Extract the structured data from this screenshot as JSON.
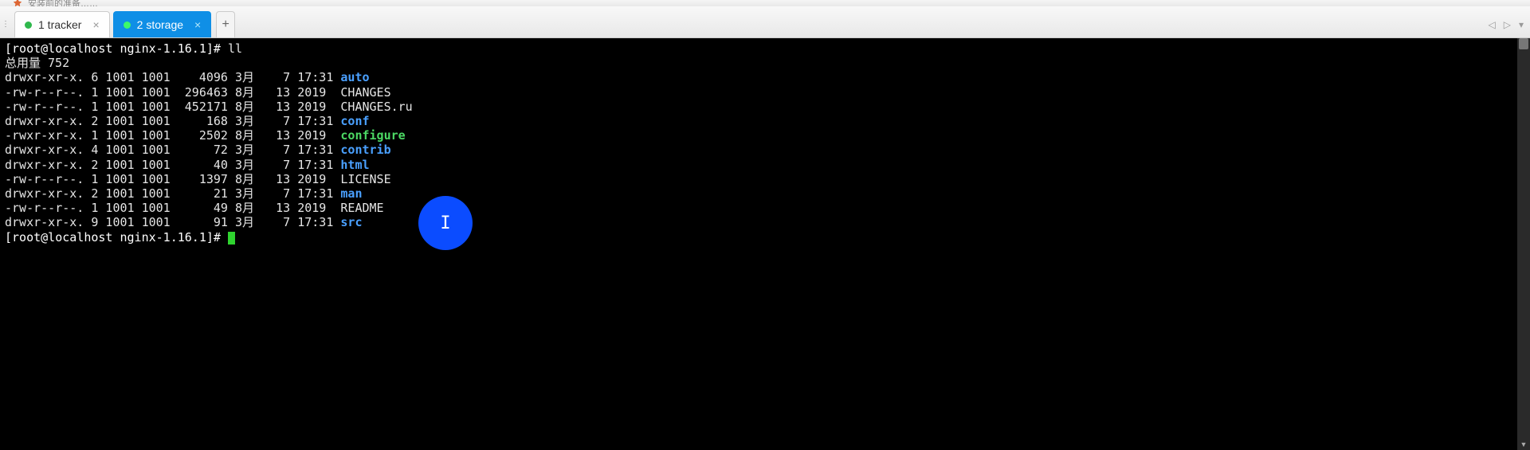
{
  "window": {
    "title_fragment": "安装前的准备……"
  },
  "tabs": {
    "items": [
      {
        "label": "1 tracker",
        "active": false
      },
      {
        "label": "2 storage",
        "active": true
      }
    ],
    "add_label": "+"
  },
  "navicons": {
    "back": "◁",
    "forward": "▷",
    "menu": "▾"
  },
  "terminal": {
    "prompt1": "[root@localhost nginx-1.16.1]# ",
    "cmd1": "ll",
    "total_line": "总用量 752",
    "rows": [
      {
        "perm": "drwxr-xr-x.",
        "n": "6",
        "u": "1001",
        "g": "1001",
        "size": "   4096",
        "mon": "3月 ",
        "day": "  7",
        "time": "17:31",
        "name": "auto",
        "cls": "dir"
      },
      {
        "perm": "-rw-r--r--.",
        "n": "1",
        "u": "1001",
        "g": "1001",
        "size": " 296463",
        "mon": "8月 ",
        "day": " 13",
        "time": "2019 ",
        "name": "CHANGES",
        "cls": ""
      },
      {
        "perm": "-rw-r--r--.",
        "n": "1",
        "u": "1001",
        "g": "1001",
        "size": " 452171",
        "mon": "8月 ",
        "day": " 13",
        "time": "2019 ",
        "name": "CHANGES.ru",
        "cls": ""
      },
      {
        "perm": "drwxr-xr-x.",
        "n": "2",
        "u": "1001",
        "g": "1001",
        "size": "    168",
        "mon": "3月 ",
        "day": "  7",
        "time": "17:31",
        "name": "conf",
        "cls": "dir"
      },
      {
        "perm": "-rwxr-xr-x.",
        "n": "1",
        "u": "1001",
        "g": "1001",
        "size": "   2502",
        "mon": "8月 ",
        "day": " 13",
        "time": "2019 ",
        "name": "configure",
        "cls": "exe"
      },
      {
        "perm": "drwxr-xr-x.",
        "n": "4",
        "u": "1001",
        "g": "1001",
        "size": "     72",
        "mon": "3月 ",
        "day": "  7",
        "time": "17:31",
        "name": "contrib",
        "cls": "dir"
      },
      {
        "perm": "drwxr-xr-x.",
        "n": "2",
        "u": "1001",
        "g": "1001",
        "size": "     40",
        "mon": "3月 ",
        "day": "  7",
        "time": "17:31",
        "name": "html",
        "cls": "dir"
      },
      {
        "perm": "-rw-r--r--.",
        "n": "1",
        "u": "1001",
        "g": "1001",
        "size": "   1397",
        "mon": "8月 ",
        "day": " 13",
        "time": "2019 ",
        "name": "LICENSE",
        "cls": ""
      },
      {
        "perm": "drwxr-xr-x.",
        "n": "2",
        "u": "1001",
        "g": "1001",
        "size": "     21",
        "mon": "3月 ",
        "day": "  7",
        "time": "17:31",
        "name": "man",
        "cls": "dir"
      },
      {
        "perm": "-rw-r--r--.",
        "n": "1",
        "u": "1001",
        "g": "1001",
        "size": "     49",
        "mon": "8月 ",
        "day": " 13",
        "time": "2019 ",
        "name": "README",
        "cls": ""
      },
      {
        "perm": "drwxr-xr-x.",
        "n": "9",
        "u": "1001",
        "g": "1001",
        "size": "     91",
        "mon": "3月 ",
        "day": "  7",
        "time": "17:31",
        "name": "src",
        "cls": "dir"
      }
    ],
    "prompt2": "[root@localhost nginx-1.16.1]# "
  },
  "pointer": {
    "glyph": "I"
  }
}
